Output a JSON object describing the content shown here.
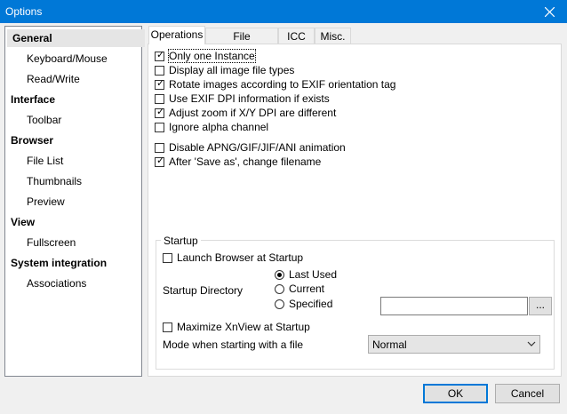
{
  "window": {
    "title": "Options"
  },
  "sidebar": {
    "items": [
      {
        "label": "General",
        "type": "category",
        "selected": true
      },
      {
        "label": "Keyboard/Mouse",
        "type": "sub"
      },
      {
        "label": "Read/Write",
        "type": "sub"
      },
      {
        "label": "Interface",
        "type": "category"
      },
      {
        "label": "Toolbar",
        "type": "sub"
      },
      {
        "label": "Browser",
        "type": "category"
      },
      {
        "label": "File List",
        "type": "sub"
      },
      {
        "label": "Thumbnails",
        "type": "sub"
      },
      {
        "label": "Preview",
        "type": "sub"
      },
      {
        "label": "View",
        "type": "category"
      },
      {
        "label": "Fullscreen",
        "type": "sub"
      },
      {
        "label": "System integration",
        "type": "category"
      },
      {
        "label": "Associations",
        "type": "sub"
      }
    ]
  },
  "tabs": [
    {
      "label": "Operations",
      "active": true
    },
    {
      "label": "File Operations"
    },
    {
      "label": "ICC"
    },
    {
      "label": "Misc."
    }
  ],
  "operations": {
    "options": [
      {
        "label": "Only one Instance",
        "checked": true
      },
      {
        "label": "Display all image file types",
        "checked": false
      },
      {
        "label": "Rotate images according to EXIF orientation tag",
        "checked": true
      },
      {
        "label": "Use EXIF DPI information if exists",
        "checked": false
      },
      {
        "label": "Adjust zoom if X/Y DPI are different",
        "checked": true
      },
      {
        "label": "Ignore alpha channel",
        "checked": false
      },
      {
        "label": "Disable APNG/GIF/JIF/ANI animation",
        "checked": false
      },
      {
        "label": "After 'Save as', change filename",
        "checked": true
      }
    ],
    "startup": {
      "title": "Startup",
      "launch_browser": {
        "label": "Launch Browser at Startup",
        "checked": false
      },
      "directory_label": "Startup Directory",
      "directory_options": [
        {
          "label": "Last Used",
          "selected": true
        },
        {
          "label": "Current",
          "selected": false
        },
        {
          "label": "Specified",
          "selected": false
        }
      ],
      "specified_path": "",
      "browse_label": "...",
      "maximize": {
        "label": "Maximize XnView at Startup",
        "checked": false
      },
      "mode_label": "Mode when starting with a file",
      "mode_value": "Normal"
    }
  },
  "footer": {
    "ok": "OK",
    "cancel": "Cancel"
  },
  "colors": {
    "titlebar": "#0078d7",
    "focus_border": "#0078d7"
  }
}
